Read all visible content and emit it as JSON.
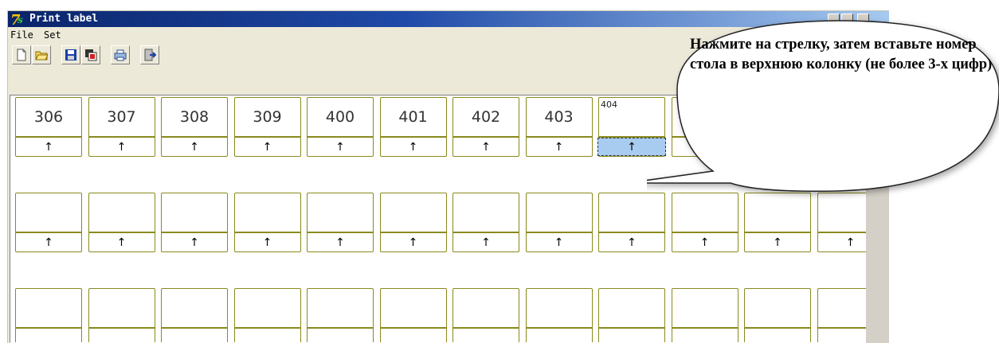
{
  "window": {
    "title": "Print label",
    "menu": [
      "File",
      "Set"
    ]
  },
  "toolbar": {
    "buttons": [
      "new-file-icon",
      "open-folder-icon",
      "save-icon",
      "save-as-icon",
      "print-icon",
      "exit-icon"
    ]
  },
  "grid": {
    "cells": [
      {
        "number": "306",
        "arrow": "↑"
      },
      {
        "number": "307",
        "arrow": "↑"
      },
      {
        "number": "308",
        "arrow": "↑"
      },
      {
        "number": "309",
        "arrow": "↑"
      },
      {
        "number": "400",
        "arrow": "↑"
      },
      {
        "number": "401",
        "arrow": "↑"
      },
      {
        "number": "402",
        "arrow": "↑"
      },
      {
        "number": "403",
        "arrow": "↑"
      },
      {
        "number": "404",
        "arrow": "↑",
        "selected": true
      },
      {
        "number": "",
        "arrow": "↑"
      },
      {
        "number": "",
        "arrow": "↑"
      },
      {
        "number": "",
        "arrow": "↑"
      },
      {
        "number": "",
        "arrow": "↑"
      },
      {
        "number": "",
        "arrow": "↑"
      },
      {
        "number": "",
        "arrow": "↑"
      },
      {
        "number": "",
        "arrow": "↑"
      },
      {
        "number": "",
        "arrow": "↑"
      },
      {
        "number": "",
        "arrow": "↑"
      },
      {
        "number": "",
        "arrow": "↑"
      },
      {
        "number": "",
        "arrow": "↑"
      },
      {
        "number": "",
        "arrow": "↑"
      },
      {
        "number": "",
        "arrow": "↑"
      },
      {
        "number": "",
        "arrow": "↑"
      },
      {
        "number": "",
        "arrow": "↑"
      },
      {
        "number": "",
        "arrow": ""
      },
      {
        "number": "",
        "arrow": ""
      },
      {
        "number": "",
        "arrow": ""
      },
      {
        "number": "",
        "arrow": ""
      },
      {
        "number": "",
        "arrow": ""
      },
      {
        "number": "",
        "arrow": ""
      },
      {
        "number": "",
        "arrow": ""
      },
      {
        "number": "",
        "arrow": ""
      },
      {
        "number": "",
        "arrow": ""
      },
      {
        "number": "",
        "arrow": ""
      },
      {
        "number": "",
        "arrow": ""
      },
      {
        "number": "",
        "arrow": ""
      }
    ]
  },
  "callout": {
    "text": "Нажмите на стрелку, затем вставьте номер стола в верхнюю колонку (не более 3-х цифр)"
  },
  "colors": {
    "title_bar": "#0a246a",
    "cell_border": "#8a8a1e",
    "selected_fill": "#a8ccf0",
    "window_bg": "#ece9d8"
  }
}
